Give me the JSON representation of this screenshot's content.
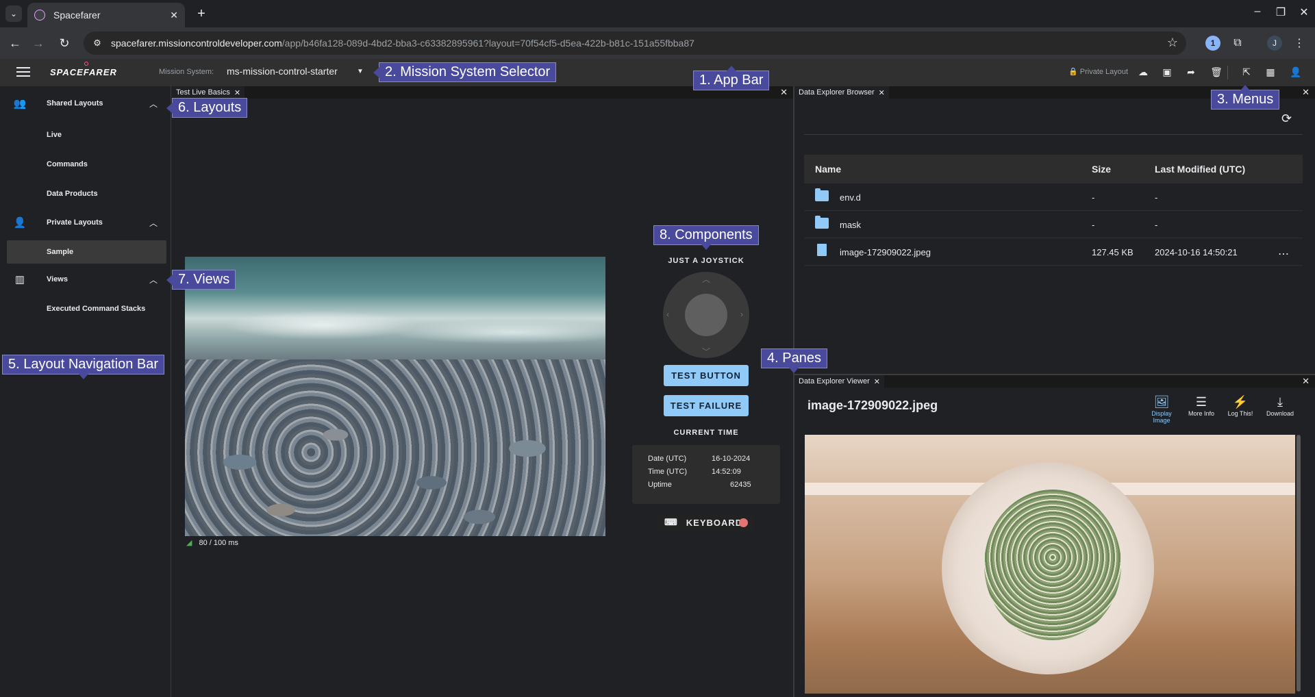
{
  "browser": {
    "tab_title": "Spacefarer",
    "url_host": "spacefarer.missioncontroldeveloper.com",
    "url_path": "/app/b46fa128-089d-4bd2-bba3-c63382895961?layout=70f54cf5-d5ea-422b-b81c-151a55fbba87",
    "profile_initial": "J"
  },
  "appbar": {
    "logo": "SPACEFARER",
    "mission_system_label": "Mission System:",
    "mission_system_value": "ms-mission-control-starter",
    "layout_status": "Private Layout"
  },
  "nav": {
    "shared_label": "Shared Layouts",
    "shared_items": [
      "Live",
      "Commands",
      "Data Products"
    ],
    "private_label": "Private Layouts",
    "private_items": [
      "Sample"
    ],
    "views_label": "Views",
    "views_items": [
      "Executed Command Stacks"
    ]
  },
  "live_pane": {
    "tab_label": "Test Live Basics",
    "latency": "80 / 100 ms",
    "joystick_title": "JUST A JOYSTICK",
    "test_button": "TEST BUTTON",
    "test_failure": "TEST FAILURE",
    "time_title": "CURRENT TIME",
    "time": {
      "date_label": "Date (UTC)",
      "date_value": "16-10-2024",
      "time_label": "Time (UTC)",
      "time_value": "14:52:09",
      "uptime_label": "Uptime",
      "uptime_value": "62435"
    },
    "keyboard_label": "KEYBOARD",
    "keyboard_status_color": "#e57373"
  },
  "browser_pane": {
    "tab_label": "Data Explorer Browser",
    "columns": [
      "Name",
      "Size",
      "Last Modified (UTC)"
    ],
    "rows": [
      {
        "name": "env.d",
        "size": "-",
        "modified": "-",
        "kind": "folder"
      },
      {
        "name": "mask",
        "size": "-",
        "modified": "-",
        "kind": "folder"
      },
      {
        "name": "image-172909022.jpeg",
        "size": "127.45 KB",
        "modified": "2024-10-16 14:50:21",
        "kind": "file"
      }
    ]
  },
  "viewer_pane": {
    "tab_label": "Data Explorer Viewer",
    "file_name": "image-172909022.jpeg",
    "actions": [
      {
        "label1": "Display",
        "label2": "Image",
        "active": true
      },
      {
        "label1": "More Info",
        "label2": ""
      },
      {
        "label1": "Log This!",
        "label2": ""
      },
      {
        "label1": "Download",
        "label2": ""
      }
    ]
  },
  "callouts": {
    "app_bar": "1. App Bar",
    "mission_selector": "2. Mission System Selector",
    "menus": "3. Menus",
    "panes": "4. Panes",
    "layout_nav": "5. Layout Navigation Bar",
    "layouts": "6. Layouts",
    "views": "7. Views",
    "components": "8. Components"
  },
  "colors": {
    "accent": "#90caf9",
    "callout": "#4a4a9c",
    "background": "#202124"
  }
}
